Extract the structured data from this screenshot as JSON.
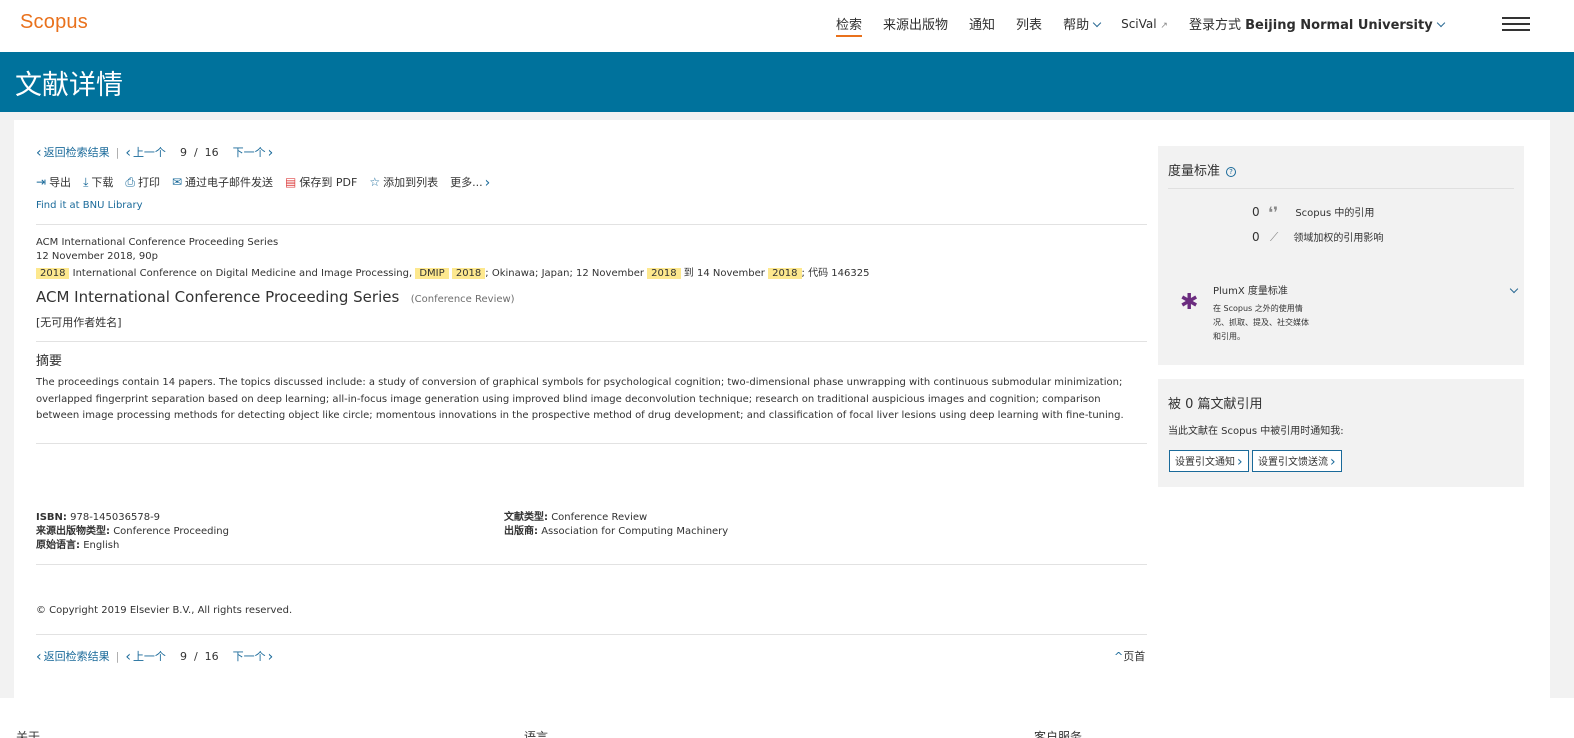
{
  "nav": {
    "logo": "Scopus",
    "items": [
      "检索",
      "来源出版物",
      "通知",
      "列表"
    ],
    "help": "帮助",
    "scival": "SciVal",
    "scival_arrow": "↗",
    "login_prefix": "登录方式",
    "login_institution": "Beijing Normal University"
  },
  "banner": {
    "title": "文献详情"
  },
  "pager": {
    "back": "返回检索结果",
    "prev": "上一个",
    "current": "9",
    "slash": "/",
    "total": "16",
    "next": "下一个"
  },
  "toolbar": {
    "export": "导出",
    "download": "下载",
    "print": "打印",
    "email": "通过电子邮件发送",
    "pdf": "保存到 PDF",
    "add_list": "添加到列表",
    "more": "更多..."
  },
  "library_link": "Find it at BNU Library",
  "source": {
    "series": "ACM International Conference Proceeding Series",
    "date_pages": "12 November 2018, 90p",
    "conf_year": "2018",
    "conf_name": "International Conference on Digital Medicine and Image Processing,",
    "conf_acronym": "DMIP",
    "conf_acronym_year": "2018",
    "conf_location": "; Okinawa; Japan; 12 November",
    "conf_start_year": "2018",
    "conf_to": "到 14 November",
    "conf_end_year": "2018",
    "conf_code": "; 代码 146325"
  },
  "title": "ACM International Conference Proceeding Series",
  "doc_type_tag": "(Conference Review)",
  "authors": "[无可用作者姓名]",
  "abstract": {
    "heading": "摘要",
    "text": "The proceedings contain 14 papers. The topics discussed include: a study of conversion of graphical symbols for psychological cognition; two-dimensional phase unwrapping with continuous submodular minimization; overlapped fingerprint separation based on deep learning; all-in-focus image generation using improved blind image deconvolution technique; research on traditional auspicious images and cognition; comparison between image processing methods for detecting object like circle; momentous innovations in the prospective method of drug development; and classification of focal liver lesions using deep learning with fine-tuning."
  },
  "meta": {
    "isbn_label": "ISBN:",
    "isbn": "978-145036578-9",
    "source_type_label": "来源出版物类型:",
    "source_type": "Conference Proceeding",
    "language_label": "原始语言:",
    "language": "English",
    "doc_type_label": "文献类型:",
    "doc_type": "Conference Review",
    "publisher_label": "出版商:",
    "publisher": "Association for Computing Machinery"
  },
  "copyright": "© Copyright 2019 Elsevier B.V., All rights reserved.",
  "top_link": "页首",
  "metrics": {
    "title": "度量标准",
    "help": "?",
    "scopus_citations": "0",
    "scopus_citations_label": "Scopus 中的引用",
    "fwci": "0",
    "fwci_label": "领域加权的引用影响",
    "plumx_title": "PlumX 度量标准",
    "plumx_desc_1": "在 Scopus 之外的使用情",
    "plumx_desc_2": "况、抓取、提及、社交媒体",
    "plumx_desc_3": "和引用。"
  },
  "cited_by": {
    "title": "被 0 篇文献引用",
    "notify": "当此文献在 Scopus 中被引用时通知我:",
    "alert_button": "设置引文通知",
    "feed_button": "设置引文馈送流"
  },
  "footer": {
    "col1": "关于",
    "col2": "语言",
    "col3": "客户服务"
  }
}
